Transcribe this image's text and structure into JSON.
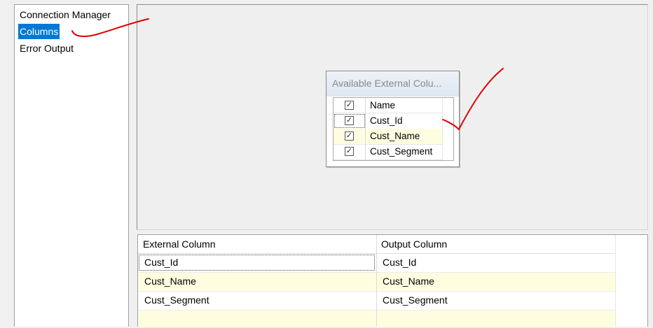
{
  "nav": {
    "items": [
      {
        "label": "Connection Manager",
        "selected": false
      },
      {
        "label": "Columns",
        "selected": true
      },
      {
        "label": "Error Output",
        "selected": false
      }
    ]
  },
  "available_columns": {
    "title": "Available External Colu...",
    "header": {
      "checked": true,
      "label": "Name"
    },
    "rows": [
      {
        "checked": true,
        "label": "Cust_Id"
      },
      {
        "checked": true,
        "label": "Cust_Name"
      },
      {
        "checked": true,
        "label": "Cust_Segment"
      }
    ]
  },
  "mapping_grid": {
    "headers": {
      "external": "External Column",
      "output": "Output Column"
    },
    "rows": [
      {
        "external": "Cust_Id",
        "output": "Cust_Id"
      },
      {
        "external": "Cust_Name",
        "output": "Cust_Name"
      },
      {
        "external": "Cust_Segment",
        "output": "Cust_Segment"
      }
    ]
  },
  "colors": {
    "selection": "#0078d7",
    "row_highlight": "#fffde0",
    "annotation_red": "#e00000"
  },
  "icons": {
    "checkbox": "check-mark-glyph"
  }
}
